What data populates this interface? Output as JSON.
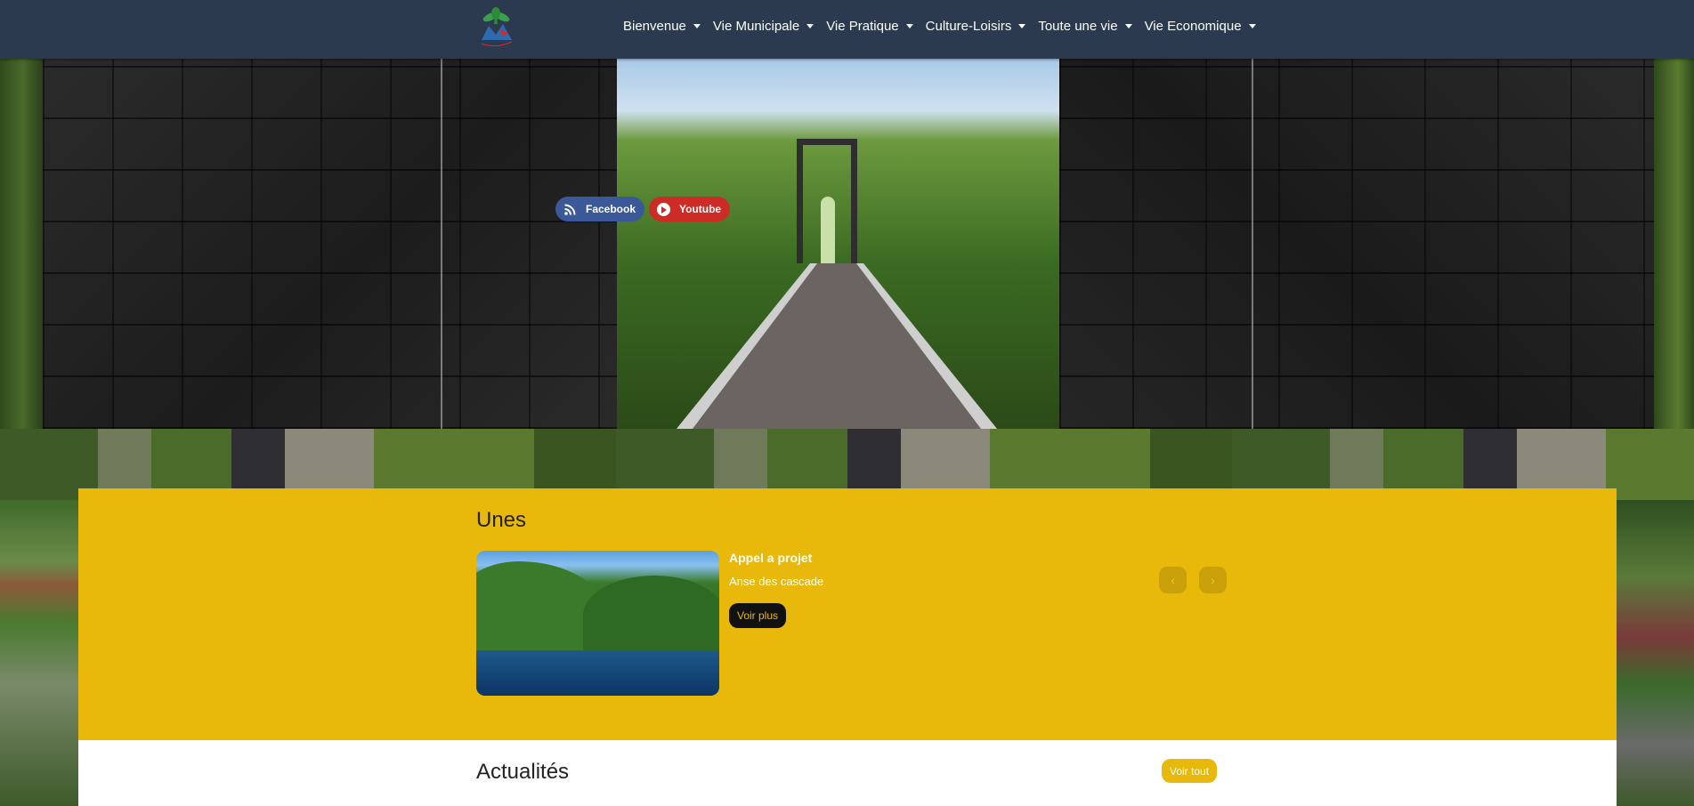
{
  "header": {
    "logo_name": "commune-logo",
    "nav": [
      {
        "label": "Bienvenue"
      },
      {
        "label": "Vie Municipale"
      },
      {
        "label": "Vie Pratique"
      },
      {
        "label": "Culture-Loisirs"
      },
      {
        "label": "Toute une vie"
      },
      {
        "label": "Vie Economique"
      }
    ]
  },
  "hero": {
    "facebook_label": "Facebook",
    "youtube_label": "Youtube"
  },
  "unes": {
    "title": "Unes",
    "item": {
      "heading": "Appel a projet",
      "subtitle": "Anse des cascade",
      "button": "Voir plus"
    },
    "prev_icon": "chevron-left-icon",
    "next_icon": "chevron-right-icon"
  },
  "actualites": {
    "title": "Actualités",
    "button": "Voir tout"
  },
  "colors": {
    "header_bg": "#2b3a4f",
    "accent_yellow": "#e8b90a",
    "facebook_blue": "#3b5998",
    "youtube_red": "#cc2b26"
  }
}
